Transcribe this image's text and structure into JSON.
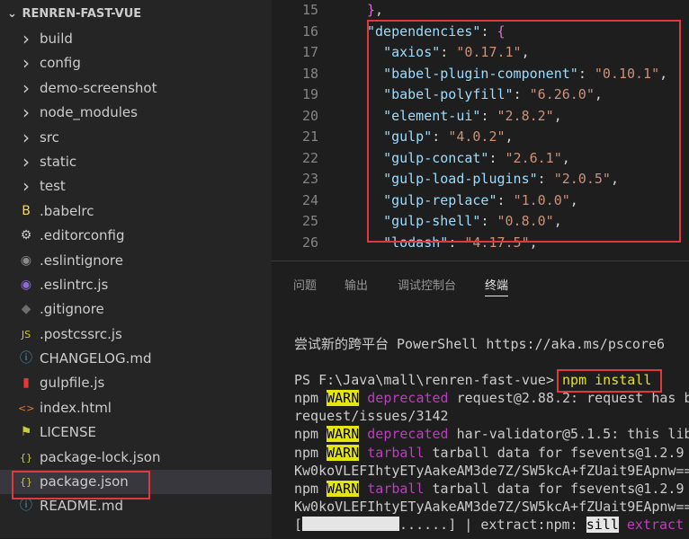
{
  "sidebar": {
    "project_title": "RENREN-FAST-VUE",
    "items": [
      {
        "label": "build",
        "icon": "chevron-right-icon",
        "glyph": "›",
        "color": "#cccccc"
      },
      {
        "label": "config",
        "icon": "chevron-right-icon",
        "glyph": "›",
        "color": "#cccccc"
      },
      {
        "label": "demo-screenshot",
        "icon": "chevron-right-icon",
        "glyph": "›",
        "color": "#cccccc"
      },
      {
        "label": "node_modules",
        "icon": "chevron-right-icon",
        "glyph": "›",
        "color": "#cccccc"
      },
      {
        "label": "src",
        "icon": "chevron-right-icon",
        "glyph": "›",
        "color": "#cccccc"
      },
      {
        "label": "static",
        "icon": "chevron-right-icon",
        "glyph": "›",
        "color": "#cccccc"
      },
      {
        "label": "test",
        "icon": "chevron-right-icon",
        "glyph": "›",
        "color": "#cccccc"
      },
      {
        "label": ".babelrc",
        "icon": "babel-icon",
        "glyph": "B",
        "color": "#f5da55"
      },
      {
        "label": ".editorconfig",
        "icon": "gear-icon",
        "glyph": "⚙",
        "color": "#cccccc"
      },
      {
        "label": ".eslintignore",
        "icon": "eslint-icon",
        "glyph": "◉",
        "color": "#8a8a8a"
      },
      {
        "label": ".eslintrc.js",
        "icon": "eslint-icon",
        "glyph": "◉",
        "color": "#8f6ad1"
      },
      {
        "label": ".gitignore",
        "icon": "git-icon",
        "glyph": "◆",
        "color": "#6d6d6d"
      },
      {
        "label": ".postcssrc.js",
        "icon": "js-icon",
        "glyph": "JS",
        "color": "#cbcb41"
      },
      {
        "label": "CHANGELOG.md",
        "icon": "info-icon",
        "glyph": "ⓘ",
        "color": "#519aba"
      },
      {
        "label": "gulpfile.js",
        "icon": "gulp-icon",
        "glyph": "▮",
        "color": "#e53935"
      },
      {
        "label": "index.html",
        "icon": "html-icon",
        "glyph": "<>",
        "color": "#e37933"
      },
      {
        "label": "LICENSE",
        "icon": "license-icon",
        "glyph": "⚑",
        "color": "#cbcb41"
      },
      {
        "label": "package-lock.json",
        "icon": "json-icon",
        "glyph": "{}",
        "color": "#cbcb41"
      },
      {
        "label": "package.json",
        "icon": "json-icon",
        "glyph": "{}",
        "color": "#cbcb41",
        "selected": true
      },
      {
        "label": "README.md",
        "icon": "info-icon",
        "glyph": "ⓘ",
        "color": "#519aba"
      }
    ]
  },
  "editor": {
    "lines": [
      {
        "num": "15",
        "html": "<span class='b'>}</span><span class='p'>,</span>"
      },
      {
        "num": "16",
        "html": "<span class='k'>\"dependencies\"</span><span class='p'>: </span><span class='b'>{</span>"
      },
      {
        "num": "17",
        "html": "  <span class='k'>\"axios\"</span><span class='p'>: </span><span class='s'>\"0.17.1\"</span><span class='p'>,</span>"
      },
      {
        "num": "18",
        "html": "  <span class='k'>\"babel-plugin-component\"</span><span class='p'>: </span><span class='s'>\"0.10.1\"</span><span class='p'>,</span>"
      },
      {
        "num": "19",
        "html": "  <span class='k'>\"babel-polyfill\"</span><span class='p'>: </span><span class='s'>\"6.26.0\"</span><span class='p'>,</span>"
      },
      {
        "num": "20",
        "html": "  <span class='k'>\"element-ui\"</span><span class='p'>: </span><span class='s'>\"2.8.2\"</span><span class='p'>,</span>"
      },
      {
        "num": "21",
        "html": "  <span class='k'>\"gulp\"</span><span class='p'>: </span><span class='s'>\"4.0.2\"</span><span class='p'>,</span>"
      },
      {
        "num": "22",
        "html": "  <span class='k'>\"gulp-concat\"</span><span class='p'>: </span><span class='s'>\"2.6.1\"</span><span class='p'>,</span>"
      },
      {
        "num": "23",
        "html": "  <span class='k'>\"gulp-load-plugins\"</span><span class='p'>: </span><span class='s'>\"2.0.5\"</span><span class='p'>,</span>"
      },
      {
        "num": "24",
        "html": "  <span class='k'>\"gulp-replace\"</span><span class='p'>: </span><span class='s'>\"1.0.0\"</span><span class='p'>,</span>"
      },
      {
        "num": "25",
        "html": "  <span class='k'>\"gulp-shell\"</span><span class='p'>: </span><span class='s'>\"0.8.0\"</span><span class='p'>,</span>"
      },
      {
        "num": "26",
        "html": "  <span class='k'>\"lodash\"</span><span class='p'>: </span><span class='s'>\"4.17.5\"</span><span class='p'>,</span>"
      }
    ]
  },
  "panel": {
    "tabs": [
      "问题",
      "输出",
      "调试控制台",
      "终端"
    ],
    "active_tab": "终端",
    "terminal": {
      "intro": "尝试新的跨平台 PowerShell https://aka.ms/pscore6",
      "prompt": "PS F:\\Java\\mall\\renren-fast-vue>",
      "command": "npm install",
      "npm": "npm",
      "warn": "WARN",
      "deprecated": "deprecated",
      "tarball": "tarball",
      "line1_rest": " request@2.88.2: request has b",
      "line2": "request/issues/3142",
      "line3_rest": " har-validator@5.1.5: this lib",
      "line4_rest": " tarball data for fsevents@1.2.9",
      "line5": "Kw0koVLEFIhtyETyAakeAM3de7Z/SW5kcA+fZUait9EApnw==",
      "line6_rest": " tarball data for fsevents@1.2.9",
      "line7": "Kw0koVLEFIhtyETyAakeAM3de7Z/SW5kcA+fZUait9EApnw==",
      "progress_open": "[",
      "progress_rest": "......] | extract:npm: ",
      "sill": "sill",
      "extract": " extract"
    }
  }
}
